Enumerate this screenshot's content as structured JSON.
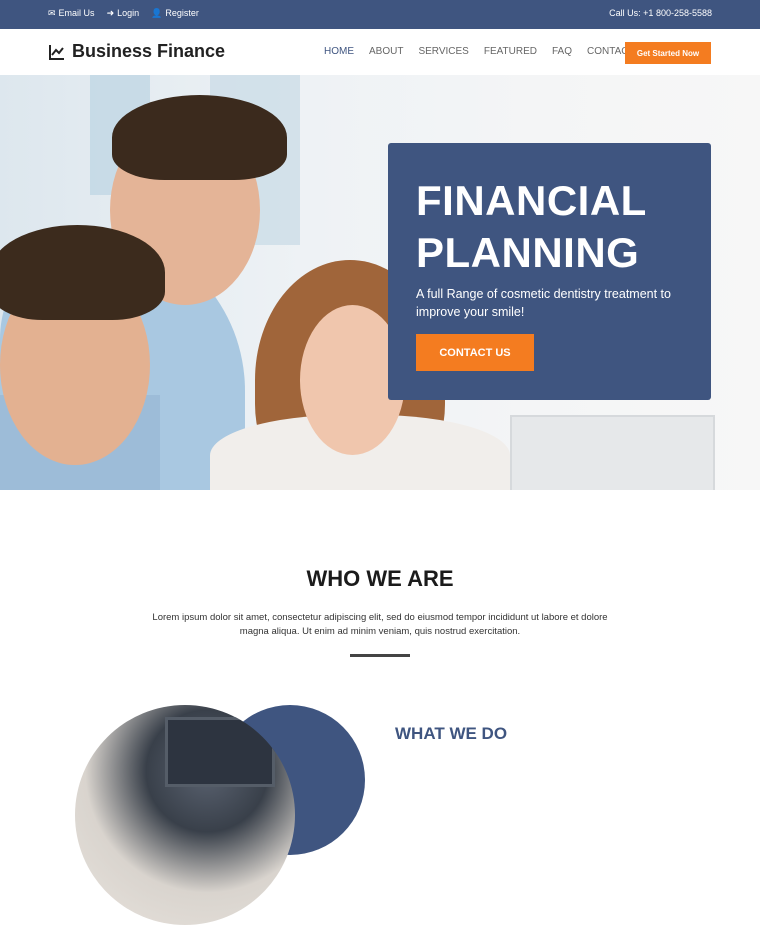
{
  "topbar": {
    "email_label": "Email Us",
    "login_label": "Login",
    "register_label": "Register",
    "call_label": "Call Us: +1 800-258-5588"
  },
  "navbar": {
    "brand": "Business Finance",
    "menu": [
      "HOME",
      "ABOUT",
      "SERVICES",
      "FEATURED",
      "FAQ",
      "CONTACT"
    ],
    "cta_label": "Get Started Now"
  },
  "hero": {
    "title_line1": "FINANCIAL",
    "title_line2": "PLANNING",
    "subtitle": "A full Range of cosmetic dentistry treatment to improve your smile!",
    "button_label": "CONTACT US"
  },
  "who_we_are": {
    "title": "WHO WE ARE",
    "text": "Lorem ipsum dolor sit amet, consectetur adipiscing elit, sed do eiusmod tempor incididunt ut labore et dolore magna aliqua. Ut enim ad minim veniam, quis nostrud exercitation."
  },
  "what_we_do": {
    "title": "WHAT WE DO"
  },
  "colors": {
    "primary": "#3f5580",
    "accent": "#f47c20"
  }
}
